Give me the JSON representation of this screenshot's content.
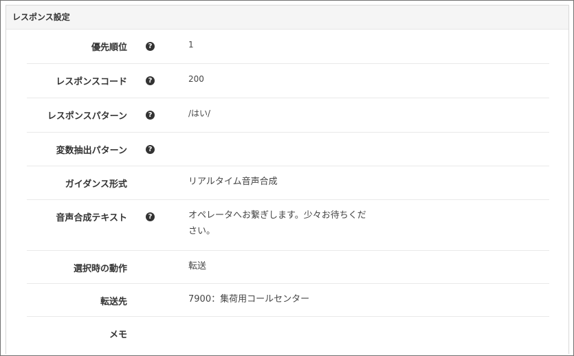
{
  "panel": {
    "title": "レスポンス設定"
  },
  "rows": [
    {
      "label": "優先順位",
      "value": "1",
      "help": true
    },
    {
      "label": "レスポンスコード",
      "value": "200",
      "help": true
    },
    {
      "label": "レスポンスパターン",
      "value": "/はい/",
      "help": true
    },
    {
      "label": "変数抽出パターン",
      "value": "",
      "help": true
    },
    {
      "label": "ガイダンス形式",
      "value": "リアルタイム音声合成",
      "help": false
    },
    {
      "label": "音声合成テキスト",
      "value": "オペレータへお繋ぎします。少々お待ちください。",
      "help": true
    },
    {
      "label": "選択時の動作",
      "value": "転送",
      "help": false
    },
    {
      "label": "転送先",
      "value": "7900：集荷用コールセンター",
      "help": false
    },
    {
      "label": "メモ",
      "value": "",
      "help": false
    }
  ],
  "icons": {
    "help": "question-circle-icon",
    "help_glyph": "?"
  }
}
